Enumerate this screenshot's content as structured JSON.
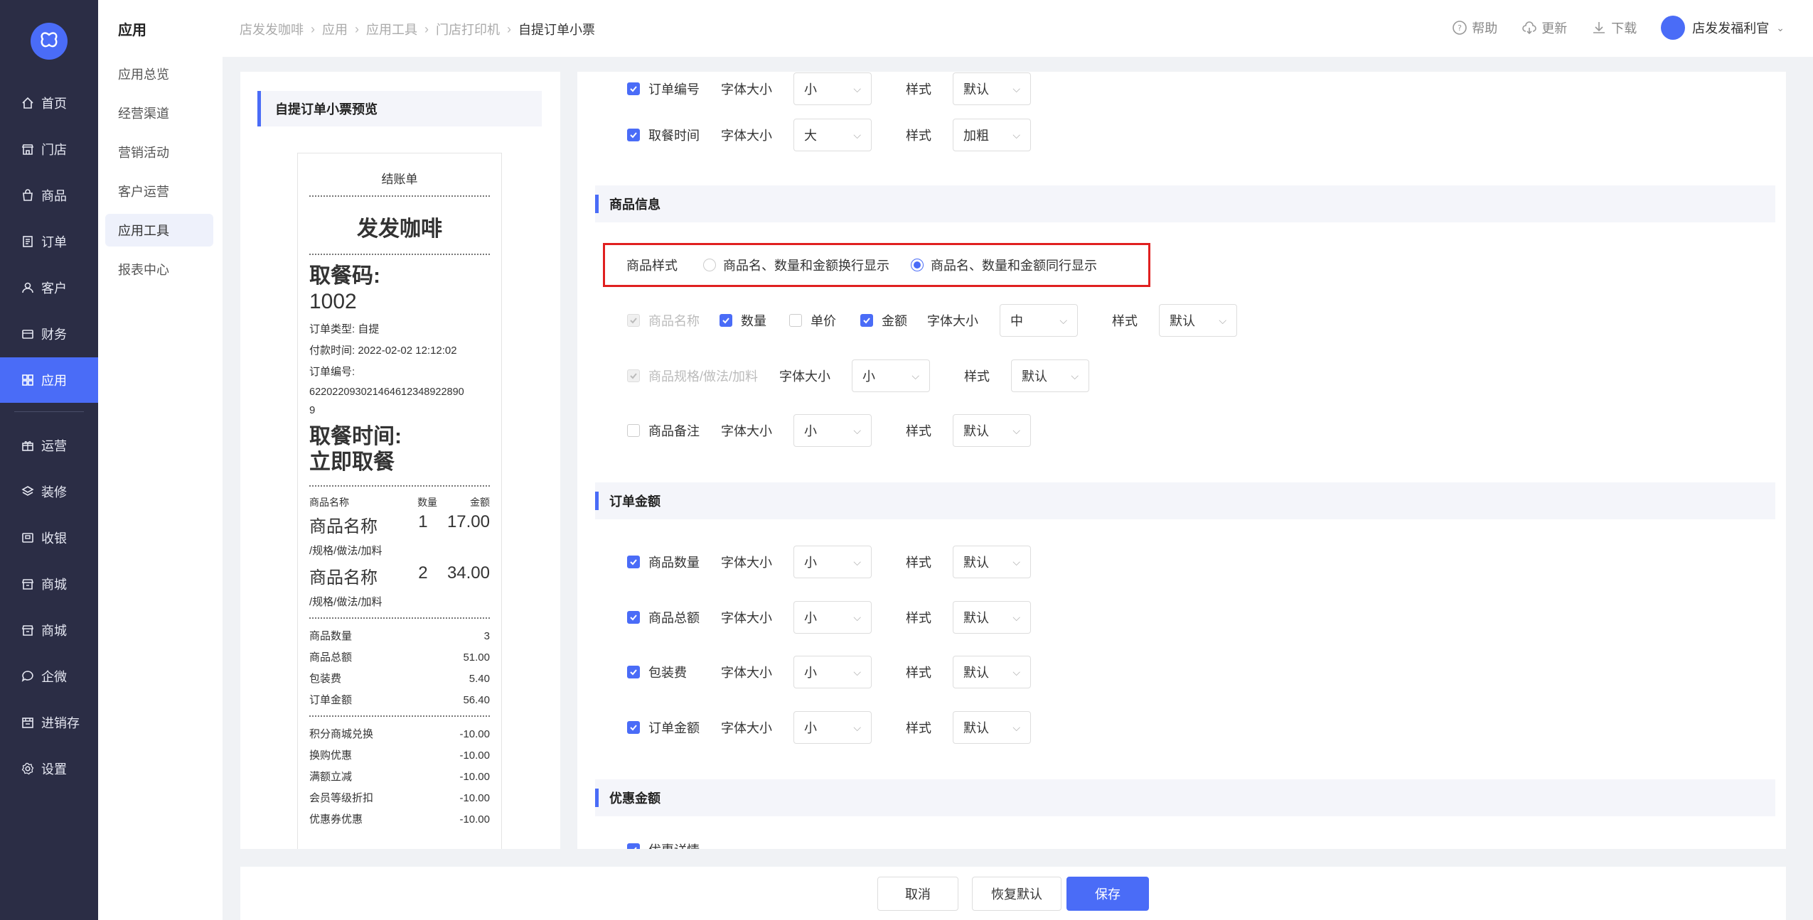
{
  "colors": {
    "accent": "#4a6cf7",
    "sidebar_bg": "#2b2d45",
    "highlight_border": "#e02020"
  },
  "nav": {
    "items": [
      {
        "label": "首页",
        "icon": "home-icon"
      },
      {
        "label": "门店",
        "icon": "store-icon"
      },
      {
        "label": "商品",
        "icon": "bag-icon"
      },
      {
        "label": "订单",
        "icon": "order-icon"
      },
      {
        "label": "客户",
        "icon": "user-icon"
      },
      {
        "label": "财务",
        "icon": "wallet-icon"
      },
      {
        "label": "应用",
        "icon": "apps-icon",
        "active": true
      },
      {
        "label": "运营",
        "icon": "gift-icon"
      },
      {
        "label": "装修",
        "icon": "layers-icon"
      },
      {
        "label": "收银",
        "icon": "cashier-icon"
      },
      {
        "label": "商城",
        "icon": "mall-icon"
      },
      {
        "label": "商城",
        "icon": "mall-icon"
      },
      {
        "label": "企微",
        "icon": "chat-icon"
      },
      {
        "label": "进销存",
        "icon": "inventory-icon"
      },
      {
        "label": "设置",
        "icon": "settings-icon"
      }
    ]
  },
  "subnav": {
    "title": "应用",
    "items": [
      "应用总览",
      "经营渠道",
      "营销活动",
      "客户运营",
      "应用工具",
      "报表中心"
    ],
    "active": "应用工具"
  },
  "breadcrumb": [
    "店发发咖啡",
    "应用",
    "应用工具",
    "门店打印机",
    "自提订单小票"
  ],
  "top": {
    "help": "帮助",
    "update": "更新",
    "download": "下载",
    "user": "店发发福利官"
  },
  "preview": {
    "title": "自提订单小票预览",
    "ticket": {
      "head": "结账单",
      "shop": "发发咖啡",
      "code_label": "取餐码:",
      "code": "1002",
      "order_type": "订单类型: 自提",
      "pay_time": "付款时间: 2022-02-02 12:12:02",
      "order_no_label": "订单编号:",
      "order_no": "622022093021464612348922890",
      "order_no_tail": "9",
      "pickup_label": "取餐时间:",
      "pickup_value": "立即取餐",
      "col_name": "商品名称",
      "col_qty": "数量",
      "col_amt": "金额",
      "items": [
        {
          "name": "商品名称",
          "qty": "1",
          "amt": "17.00",
          "spec": "/规格/做法/加料"
        },
        {
          "name": "商品名称",
          "qty": "2",
          "amt": "34.00",
          "spec": "/规格/做法/加料"
        }
      ],
      "totals": [
        {
          "k": "商品数量",
          "v": "3"
        },
        {
          "k": "商品总额",
          "v": "51.00"
        },
        {
          "k": "包装费",
          "v": "5.40"
        },
        {
          "k": "订单金额",
          "v": "56.40"
        }
      ],
      "discounts": [
        {
          "k": "积分商城兑换",
          "v": "-10.00"
        },
        {
          "k": "换购优惠",
          "v": "-10.00"
        },
        {
          "k": "满额立减",
          "v": "-10.00"
        },
        {
          "k": "会员等级折扣",
          "v": "-10.00"
        },
        {
          "k": "优惠券优惠",
          "v": "-10.00"
        }
      ]
    }
  },
  "config": {
    "top_rows": [
      {
        "label": "订单编号",
        "size_label": "字体大小",
        "size": "小",
        "style_label": "样式",
        "style": "默认"
      },
      {
        "label": "取餐时间",
        "size_label": "字体大小",
        "size": "大",
        "style_label": "样式",
        "style": "加粗"
      }
    ],
    "goods_section": "商品信息",
    "goods_style_label": "商品样式",
    "goods_style_opt1": "商品名、数量和金额换行显示",
    "goods_style_opt2": "商品名、数量和金额同行显示",
    "goods_row1": {
      "name": "商品名称",
      "qty": "数量",
      "price": "单价",
      "amount": "金额",
      "size_label": "字体大小",
      "size": "中",
      "style_label": "样式",
      "style": "默认"
    },
    "goods_row2": {
      "label": "商品规格/做法/加料",
      "size_label": "字体大小",
      "size": "小",
      "style_label": "样式",
      "style": "默认"
    },
    "goods_row3": {
      "label": "商品备注",
      "size_label": "字体大小",
      "size": "小",
      "style_label": "样式",
      "style": "默认"
    },
    "amount_section": "订单金额",
    "amount_rows": [
      {
        "label": "商品数量",
        "size_label": "字体大小",
        "size": "小",
        "style_label": "样式",
        "style": "默认"
      },
      {
        "label": "商品总额",
        "size_label": "字体大小",
        "size": "小",
        "style_label": "样式",
        "style": "默认"
      },
      {
        "label": "包装费",
        "size_label": "字体大小",
        "size": "小",
        "style_label": "样式",
        "style": "默认"
      },
      {
        "label": "订单金额",
        "size_label": "字体大小",
        "size": "小",
        "style_label": "样式",
        "style": "默认"
      }
    ],
    "discount_section": "优惠金额",
    "discount_partial": "优惠详情"
  },
  "footer": {
    "cancel": "取消",
    "reset": "恢复默认",
    "save": "保存"
  }
}
